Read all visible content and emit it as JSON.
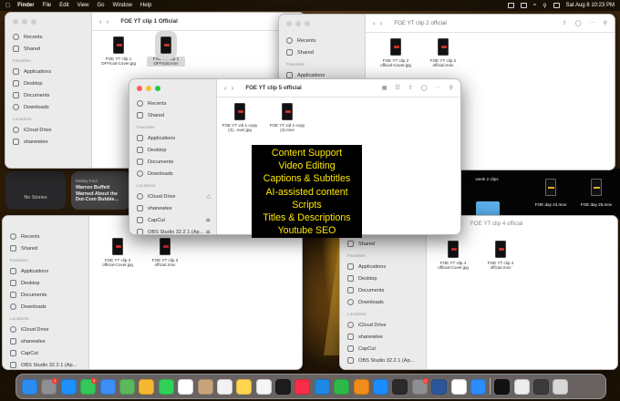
{
  "menubar": {
    "app_name": "Finder",
    "menus": [
      "File",
      "Edit",
      "View",
      "Go",
      "Window",
      "Help"
    ],
    "datetime": "Sat Aug 8  10:23 PM"
  },
  "sidebar": {
    "favorites_heading": "Favorites",
    "locations_heading": "Locations",
    "recents": "Recents",
    "shared": "Shared",
    "applications": "Applications",
    "desktop": "Desktop",
    "documents": "Documents",
    "downloads": "Downloads",
    "icloud": "iCloud Drive",
    "user": "shanewlee",
    "capcut": "CapCut",
    "obs": "OBS Studio 32.2.1 (Ap..."
  },
  "windows": {
    "clip1": {
      "title": "FOE YT clip 1 Official",
      "files": [
        {
          "name": "FOE YT clip 1 OFFicial-Cover.jpg"
        },
        {
          "name": "FOE YT clip 1 OFFicial.mov"
        }
      ]
    },
    "clip2": {
      "title": "FOE YT clip 2 official",
      "files": [
        {
          "name": "FOE YT clip 2 official-Cover.jpg"
        },
        {
          "name": "FOE YT clip 2 official.mov"
        }
      ]
    },
    "clip5": {
      "title": "FOE YT clip 5 official",
      "files": [
        {
          "name": "FOE YT vid 1-copy (4)...over.jpg"
        },
        {
          "name": "FOE YT vid 1-copy (4).mov"
        }
      ]
    },
    "clip3": {
      "files": [
        {
          "name": "FOE YT clip 3 official-Cover.jpg"
        },
        {
          "name": "FOE YT clip 3 official.mov"
        }
      ]
    },
    "clip4": {
      "title": "FOE YT clip 4 official",
      "files": [
        {
          "name": "FOE YT clip 4 official-Cover.jpg"
        },
        {
          "name": "FOE YT clip 4 official.mov"
        }
      ]
    }
  },
  "widgets": {
    "stories": "No Stories",
    "news_source": "Motley Fool",
    "news_headline": "Warren Buffett Warned About the Dot-Com Bubble..."
  },
  "desktop": {
    "folder_label": "week 2 clips",
    "day24": "FOE day 24.mov",
    "day25": "FOE day 25.mov"
  },
  "promo": {
    "lines": [
      "Content Support",
      "Video Editing",
      "Captions & Subtitles",
      "AI-assisted content",
      "Scripts",
      "Titles & Descriptions",
      "Youtube SEO"
    ]
  },
  "dock": {
    "icons": [
      {
        "name": "finder-icon",
        "color": "#2d8cf0"
      },
      {
        "name": "settings-icon",
        "color": "#8e8e93",
        "badge": "1"
      },
      {
        "name": "safari-icon",
        "color": "#1e90ff"
      },
      {
        "name": "messages-icon",
        "color": "#34c759",
        "badge": "9"
      },
      {
        "name": "mail-icon",
        "color": "#3d8ef7"
      },
      {
        "name": "maps-icon",
        "color": "#5cb85c"
      },
      {
        "name": "photos-icon",
        "color": "#f7b731"
      },
      {
        "name": "facetime-icon",
        "color": "#30d158"
      },
      {
        "name": "calendar-icon",
        "color": "#ffffff"
      },
      {
        "name": "contacts-icon",
        "color": "#c8a27a"
      },
      {
        "name": "reminders-icon",
        "color": "#f2f2f2"
      },
      {
        "name": "notes-icon",
        "color": "#ffd54f"
      },
      {
        "name": "freeform-icon",
        "color": "#f5f5f5"
      },
      {
        "name": "tv-icon",
        "color": "#1c1c1e"
      },
      {
        "name": "music-icon",
        "color": "#fa2d48"
      },
      {
        "name": "keynote-icon",
        "color": "#1e88e5"
      },
      {
        "name": "numbers-icon",
        "color": "#2fb84a"
      },
      {
        "name": "pages-icon",
        "color": "#f08c1a"
      },
      {
        "name": "app-store-icon",
        "color": "#1a8cff"
      },
      {
        "name": "final-cut-icon",
        "color": "#2b2b2b"
      },
      {
        "name": "system-preferences-icon",
        "color": "#8e8e93",
        "badge": "1"
      },
      {
        "name": "word-icon",
        "color": "#2b579a"
      },
      {
        "name": "chrome-icon",
        "color": "#ffffff"
      },
      {
        "name": "zoom-icon",
        "color": "#2d8cff"
      },
      {
        "name": "capcut-icon",
        "color": "#111111"
      },
      {
        "name": "preview-icon",
        "color": "#ededed"
      },
      {
        "name": "screenshot-icon",
        "color": "#3a3a3c"
      },
      {
        "name": "trash-icon",
        "color": "#d8d8d8"
      }
    ]
  }
}
